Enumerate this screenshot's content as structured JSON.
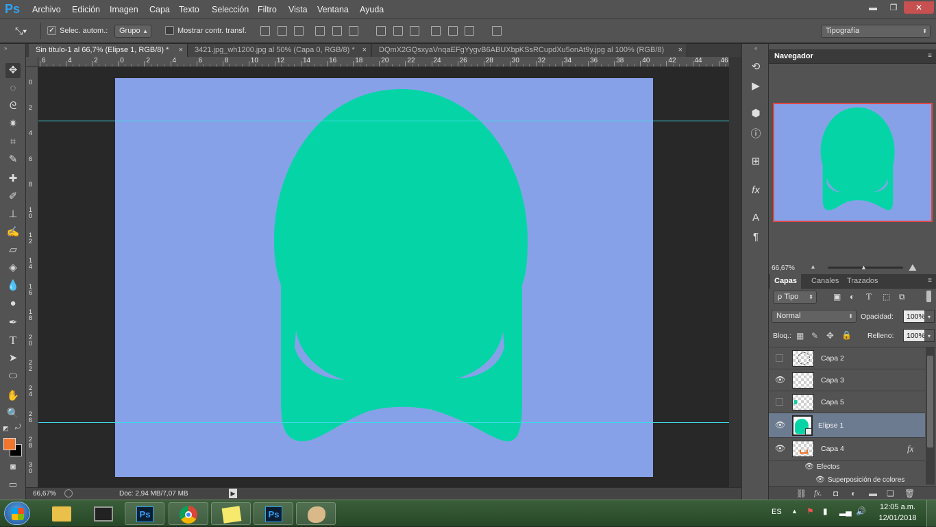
{
  "app": {
    "logo": "Ps",
    "menu": [
      "Archivo",
      "Edición",
      "Imagen",
      "Capa",
      "Texto",
      "Selección",
      "Filtro",
      "Vista",
      "Ventana",
      "Ayuda"
    ],
    "window_controls": {
      "minimize": "▬",
      "restore": "❐",
      "close": "✕"
    }
  },
  "options_bar": {
    "auto_select_label": "Selec. autom.:",
    "auto_select_checked": true,
    "auto_select_target": "Grupo",
    "show_transform_label": "Mostrar contr. transf.",
    "show_transform_checked": false,
    "workspace_preset": "Tipografía"
  },
  "tabs": [
    {
      "title": "Sin título-1 al 66,7% (Elipse 1, RGB/8) *",
      "close": "×",
      "active": true
    },
    {
      "title": "3421.jpg_wh1200.jpg al 50% (Capa 0, RGB/8) *",
      "close": "×",
      "active": false
    },
    {
      "title": "DQmX2GQsxyaVnqaEFgYygvB6ABUXbpKSsRCupdXu5onAt9y.jpg al 100% (RGB/8)",
      "close": "×",
      "active": false
    }
  ],
  "rulers": {
    "top_labels": [
      "6",
      "4",
      "2",
      "0",
      "2",
      "4",
      "6",
      "8",
      "10",
      "12",
      "14",
      "16",
      "18",
      "20",
      "22",
      "24",
      "26",
      "28",
      "30",
      "32",
      "34",
      "36",
      "38",
      "40",
      "42",
      "44",
      "46"
    ],
    "left_labels": [
      "0",
      "2",
      "4",
      "6",
      "8",
      "1\n0",
      "1\n2",
      "1\n4",
      "1\n6",
      "1\n8",
      "2\n0",
      "2\n2",
      "2\n4",
      "2\n6",
      "2\n8",
      "3\n0"
    ]
  },
  "canvas": {
    "background": "#87a1e9",
    "shape_color": "#05d5a6",
    "guide_color": "#3ed7e5"
  },
  "status": {
    "zoom": "66,67%",
    "doc_info": "Doc: 2,94 MB/7,07 MB"
  },
  "navigator": {
    "title": "Navegador",
    "zoom": "66,67%",
    "frame_color": "#e04848"
  },
  "layers_panel": {
    "tabs": [
      "Capas",
      "Canales",
      "Trazados"
    ],
    "filter_label": "ρ Tipo",
    "blend_mode": "Normal",
    "opacity_label": "Opacidad:",
    "opacity_value": "100%",
    "lock_label": "Bloq.:",
    "fill_label": "Relleno:",
    "fill_value": "100%",
    "layers": [
      {
        "name": "Capa 2",
        "visible": false,
        "selected": false
      },
      {
        "name": "Capa 3",
        "visible": true,
        "selected": false
      },
      {
        "name": "Capa 5",
        "visible": false,
        "selected": false
      },
      {
        "name": "Elipse 1",
        "visible": true,
        "selected": true
      },
      {
        "name": "Capa 4",
        "visible": true,
        "selected": false,
        "fx": "fx"
      }
    ],
    "effects_label": "Efectos",
    "effect_item": "Superposición de colores"
  },
  "taskbar": {
    "language": "ES",
    "time": "12:05 a.m.",
    "date": "12/01/2018"
  }
}
